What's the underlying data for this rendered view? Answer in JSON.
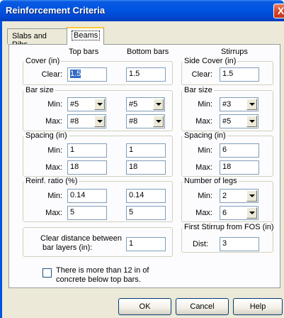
{
  "window": {
    "title": "Reinforcement Criteria",
    "close_glyph": "X"
  },
  "tabs": [
    {
      "label": "Slabs and Ribs"
    },
    {
      "label": "Beams"
    }
  ],
  "headers": {
    "top_bars": "Top bars",
    "bottom_bars": "Bottom bars",
    "stirrups": "Stirrups"
  },
  "cover": {
    "title": "Cover (in)",
    "clear_label": "Clear:",
    "top": "1.5",
    "bottom": "1.5"
  },
  "bar_size": {
    "title": "Bar size",
    "min_label": "Min:",
    "max_label": "Max:",
    "top_min": "#5",
    "top_max": "#8",
    "bottom_min": "#5",
    "bottom_max": "#8"
  },
  "spacing": {
    "title": "Spacing (in)",
    "min_label": "Min:",
    "max_label": "Max:",
    "top_min": "1",
    "top_max": "18",
    "bottom_min": "1",
    "bottom_max": "18"
  },
  "reinf_ratio": {
    "title": "Reinf. ratio (%)",
    "min_label": "Min:",
    "max_label": "Max:",
    "top_min": "0.14",
    "top_max": "5",
    "bottom_min": "0.14",
    "bottom_max": "5"
  },
  "clear_distance": {
    "label_line1": "Clear distance between",
    "label_line2": "bar layers (in):",
    "value": "1"
  },
  "stirrups": {
    "side_cover_title": "Side Cover (in)",
    "clear_label": "Clear:",
    "side_cover": "1.5",
    "bar_size_title": "Bar size",
    "min_label": "Min:",
    "max_label": "Max:",
    "bar_min": "#3",
    "bar_max": "#5",
    "spacing_title": "Spacing (in)",
    "spacing_min": "6",
    "spacing_max": "18",
    "legs_title": "Number of legs",
    "legs_min": "2",
    "legs_max": "6",
    "first_title": "First Stirrup from FOS (in)",
    "dist_label": "Dist:",
    "dist": "3"
  },
  "checkbox": {
    "line1": "There is more than 12 in of",
    "line2": "concrete below top bars.",
    "checked": false
  },
  "buttons": {
    "ok": "OK",
    "cancel": "Cancel",
    "help": "Help"
  }
}
